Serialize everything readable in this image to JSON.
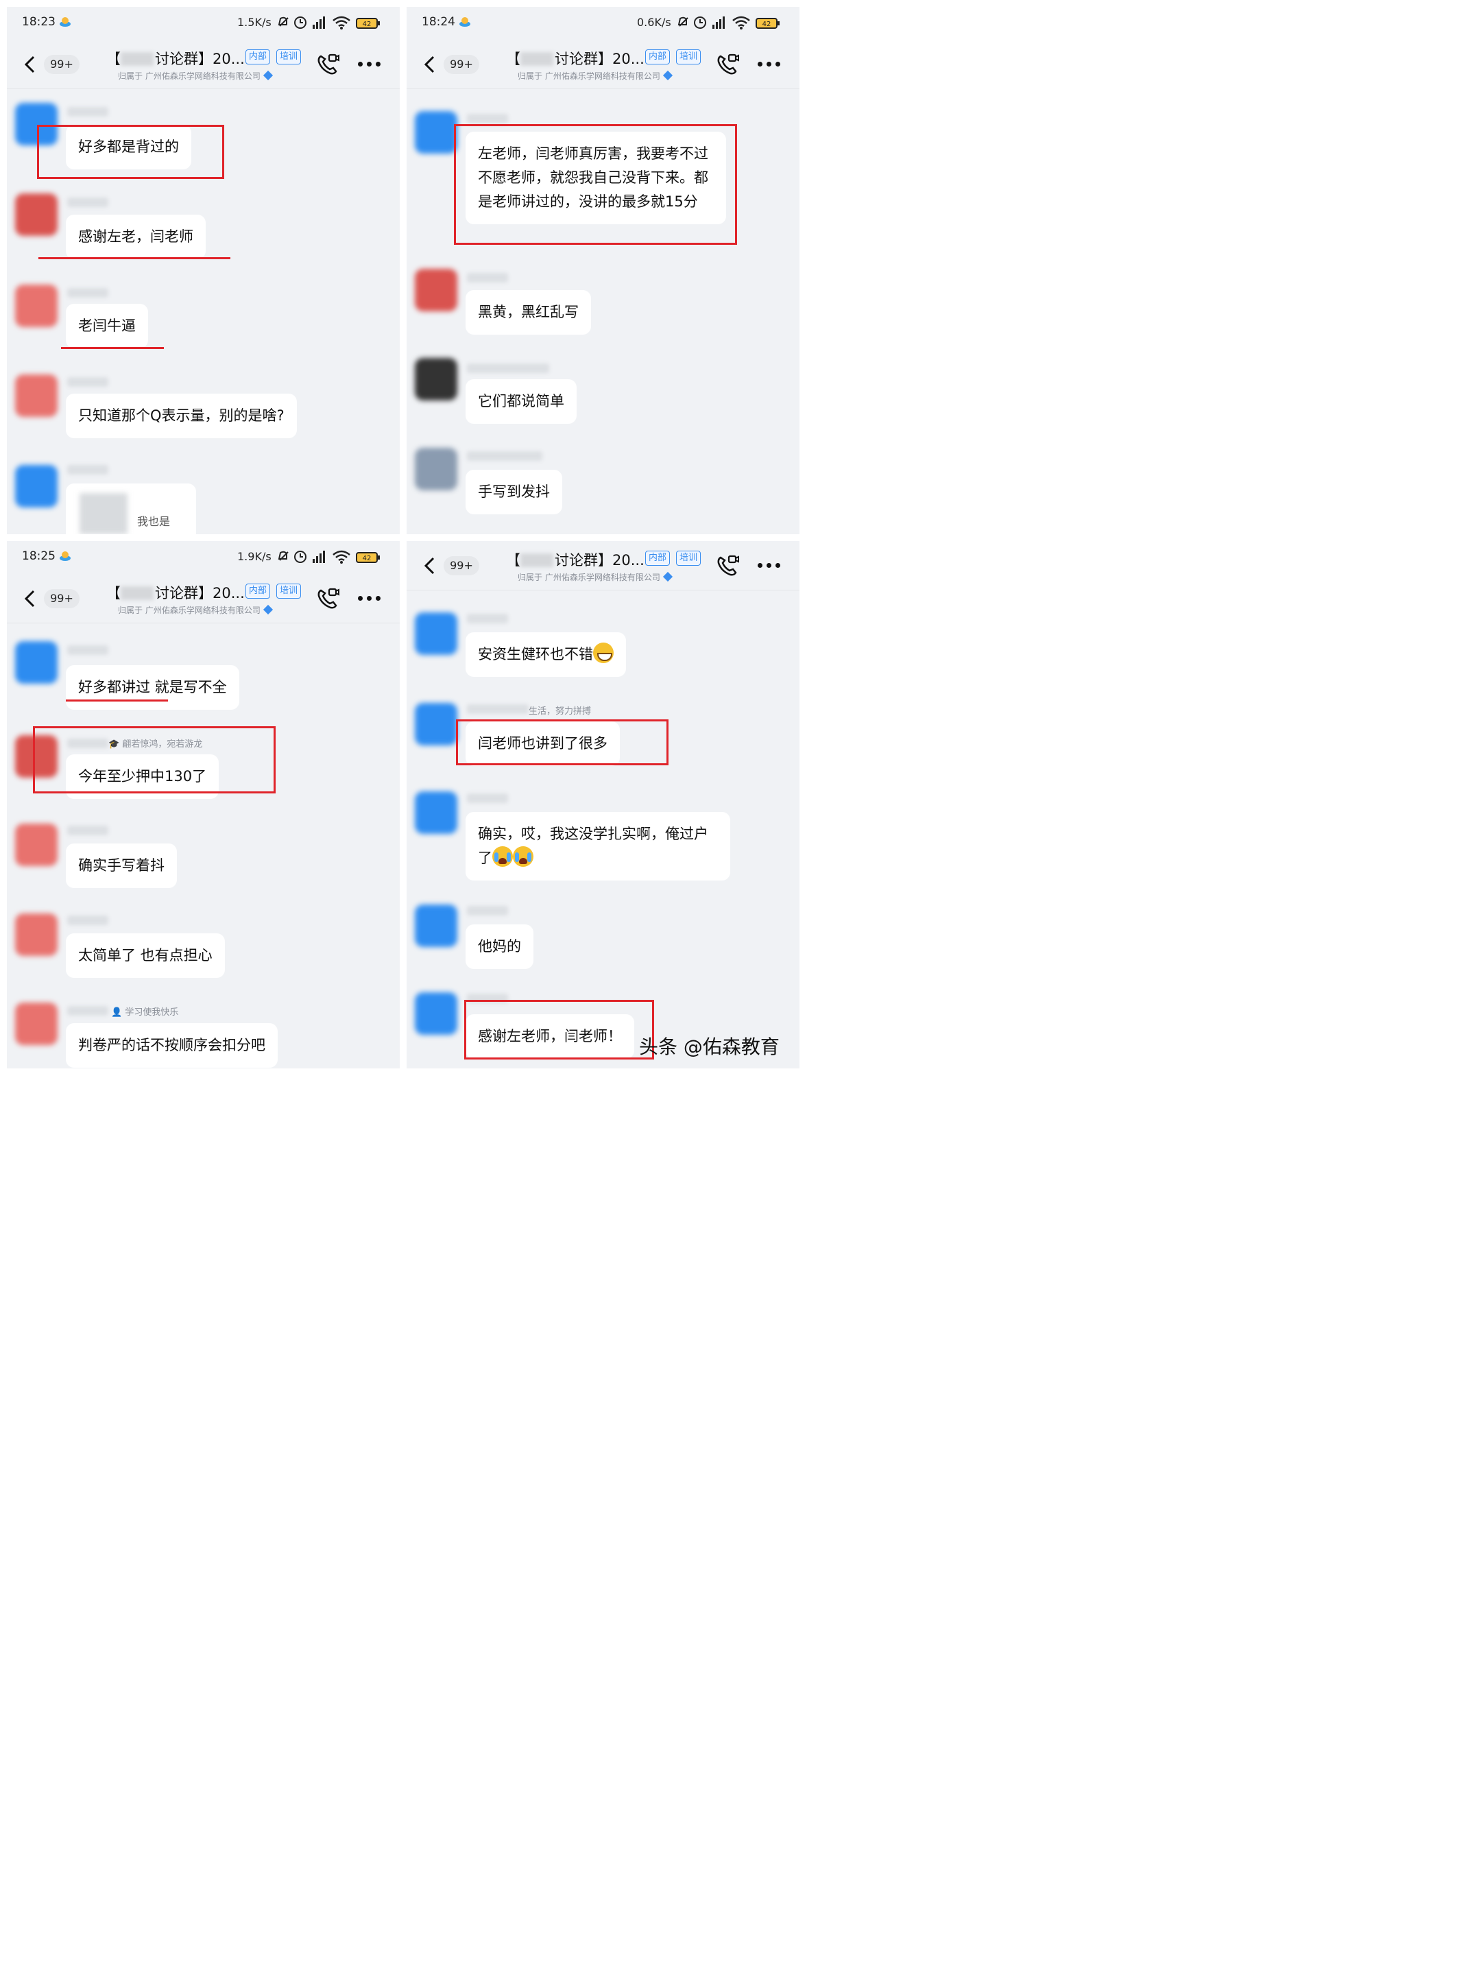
{
  "status_panels": [
    {
      "time": "18:23",
      "speed": "1.5K/s",
      "battery": "42"
    },
    {
      "time": "18:24",
      "speed": "0.6K/s",
      "battery": "42"
    },
    {
      "time": "18:25",
      "speed": "1.9K/s",
      "battery": "42"
    }
  ],
  "header": {
    "unread": "99+",
    "title_prefix": "【",
    "title_rest": "讨论群】20...",
    "tag_internal": "内部",
    "tag_training": "培训",
    "subtitle": "归属于 广州佑森乐学网络科技有限公司"
  },
  "panel1": {
    "msgs": [
      "好多都是背过的",
      "感谢左老，闫老师",
      "老闫牛逼",
      "只知道那个Q表示量，别的是啥?",
      "我也是"
    ]
  },
  "panel2": {
    "msgs": [
      "左老师，闫老师真厉害，我要考不过不愿老师，就怨我自己没背下来。都是老师讲过的，没讲的最多就15分",
      "黑黄，黑红乱写",
      "它们都说简单",
      "手写到发抖"
    ]
  },
  "panel3": {
    "msgs": [
      "好多都讲过  就是写不全",
      "今年至少押中130了",
      "确实手写着抖",
      "太简单了 也有点担心",
      "判卷严的话不按顺序会扣分吧"
    ],
    "subnames": [
      "翩若惊鸿，宛若游龙",
      "学习使我快乐"
    ]
  },
  "panel4": {
    "msgs": [
      "安资生健环也不错",
      "闫老师也讲到了很多",
      "确实，哎，我这没学扎实啊，俺过户了",
      "他妈的",
      "感谢左老师，闫老师！"
    ],
    "subnames": [
      "生活，努力拼搏"
    ]
  },
  "watermark": "头条 @佑森教育",
  "colors": {
    "accent": "#3a8ef0",
    "highlight": "#e0242a",
    "chat_bg": "#f0f2f5"
  }
}
